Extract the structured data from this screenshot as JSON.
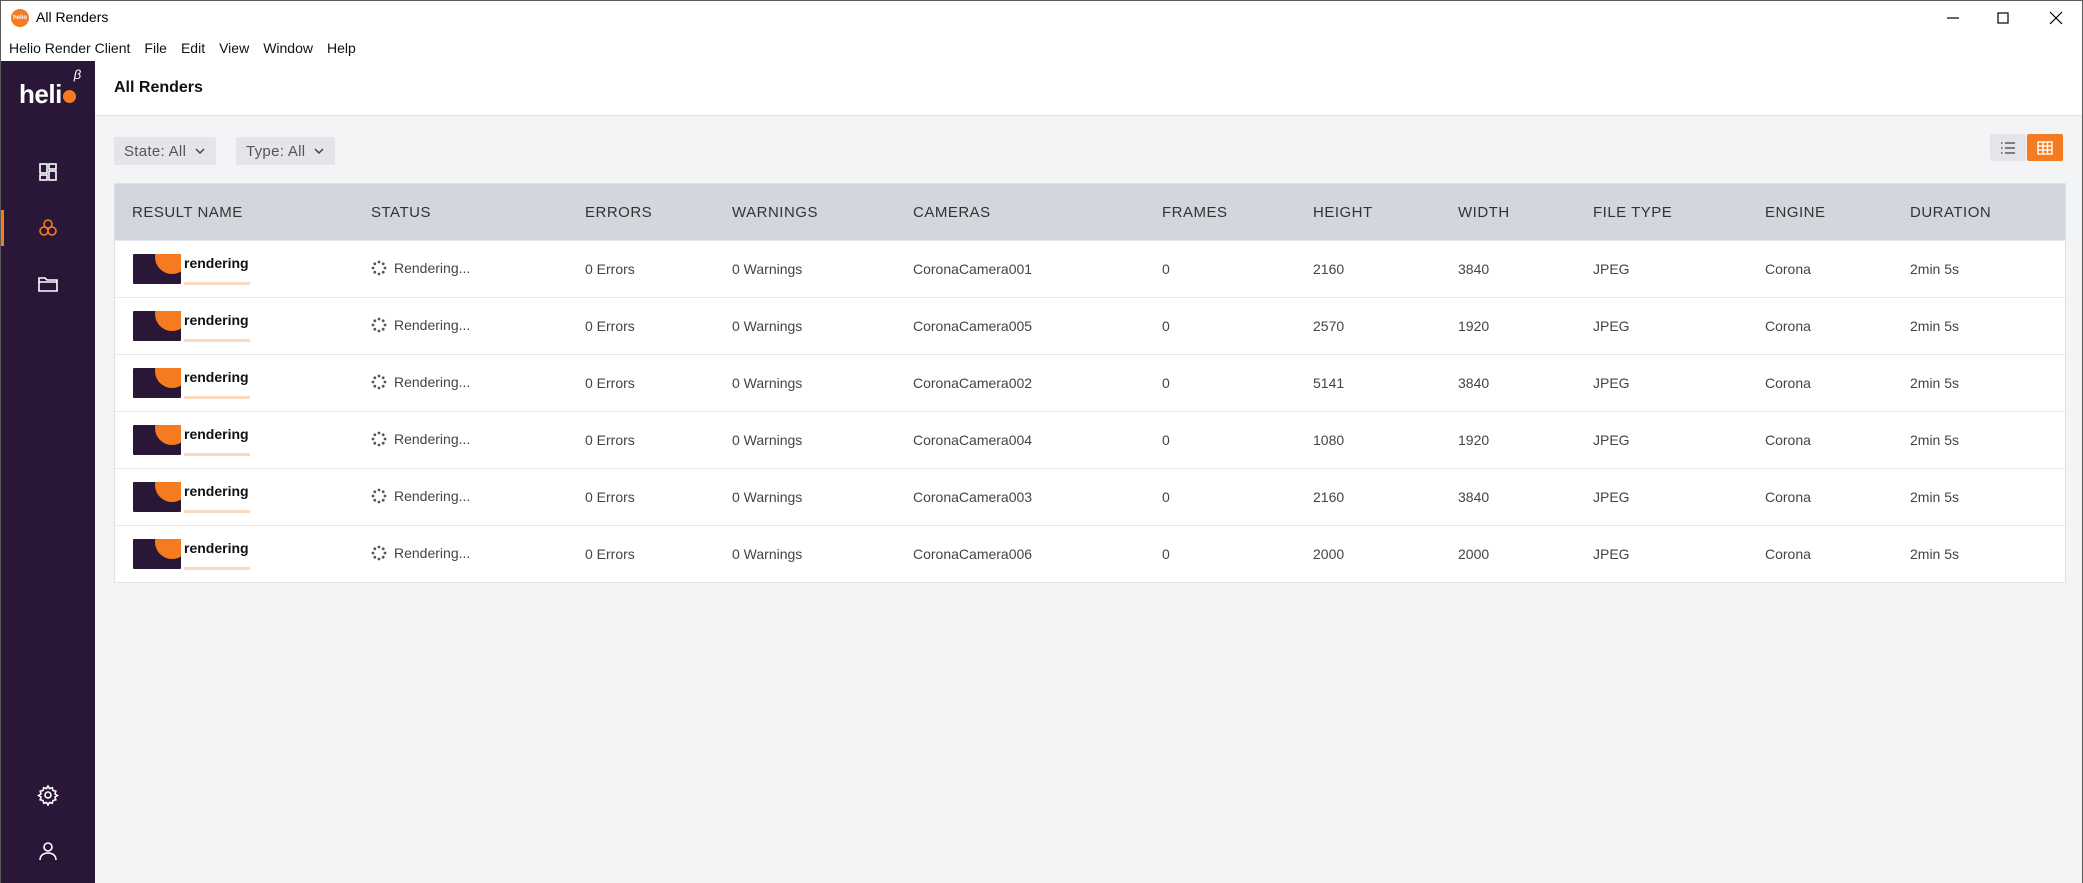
{
  "window": {
    "title": "All Renders",
    "logo_text": "helio"
  },
  "menu": [
    "Helio Render Client",
    "File",
    "Edit",
    "View",
    "Window",
    "Help"
  ],
  "sidebar": {
    "brand": "heli",
    "brand_sup": "β",
    "items": [
      {
        "name": "dashboard",
        "icon": "dashboard-icon"
      },
      {
        "name": "renders",
        "icon": "renders-icon",
        "active": true
      },
      {
        "name": "files",
        "icon": "folder-icon"
      },
      {
        "name": "settings",
        "icon": "gear-icon"
      },
      {
        "name": "account",
        "icon": "user-icon"
      }
    ]
  },
  "page": {
    "title": "All Renders",
    "filters": {
      "state": "State: All",
      "type": "Type: All"
    },
    "view_modes": [
      "list-view-icon",
      "grid-view-icon"
    ],
    "active_view": "grid"
  },
  "colors": {
    "accent": "#f47b20",
    "sidebar": "#2a1738",
    "header_row": "#d4d6de"
  },
  "table": {
    "columns": [
      "RESULT NAME",
      "STATUS",
      "ERRORS",
      "WARNINGS",
      "CAMERAS",
      "FRAMES",
      "HEIGHT",
      "WIDTH",
      "FILE TYPE",
      "ENGINE",
      "DURATION"
    ],
    "rows": [
      {
        "name": "rendering",
        "status": "Rendering...",
        "errors": "0 Errors",
        "warnings": "0 Warnings",
        "camera": "CoronaCamera001",
        "frames": "0",
        "height": "2160",
        "width": "3840",
        "filetype": "JPEG",
        "engine": "Corona",
        "duration": "2min 5s"
      },
      {
        "name": "rendering",
        "status": "Rendering...",
        "errors": "0 Errors",
        "warnings": "0 Warnings",
        "camera": "CoronaCamera005",
        "frames": "0",
        "height": "2570",
        "width": "1920",
        "filetype": "JPEG",
        "engine": "Corona",
        "duration": "2min 5s"
      },
      {
        "name": "rendering",
        "status": "Rendering...",
        "errors": "0 Errors",
        "warnings": "0 Warnings",
        "camera": "CoronaCamera002",
        "frames": "0",
        "height": "5141",
        "width": "3840",
        "filetype": "JPEG",
        "engine": "Corona",
        "duration": "2min 5s"
      },
      {
        "name": "rendering",
        "status": "Rendering...",
        "errors": "0 Errors",
        "warnings": "0 Warnings",
        "camera": "CoronaCamera004",
        "frames": "0",
        "height": "1080",
        "width": "1920",
        "filetype": "JPEG",
        "engine": "Corona",
        "duration": "2min 5s"
      },
      {
        "name": "rendering",
        "status": "Rendering...",
        "errors": "0 Errors",
        "warnings": "0 Warnings",
        "camera": "CoronaCamera003",
        "frames": "0",
        "height": "2160",
        "width": "3840",
        "filetype": "JPEG",
        "engine": "Corona",
        "duration": "2min 5s"
      },
      {
        "name": "rendering",
        "status": "Rendering...",
        "errors": "0 Errors",
        "warnings": "0 Warnings",
        "camera": "CoronaCamera006",
        "frames": "0",
        "height": "2000",
        "width": "2000",
        "filetype": "JPEG",
        "engine": "Corona",
        "duration": "2min 5s"
      }
    ]
  }
}
